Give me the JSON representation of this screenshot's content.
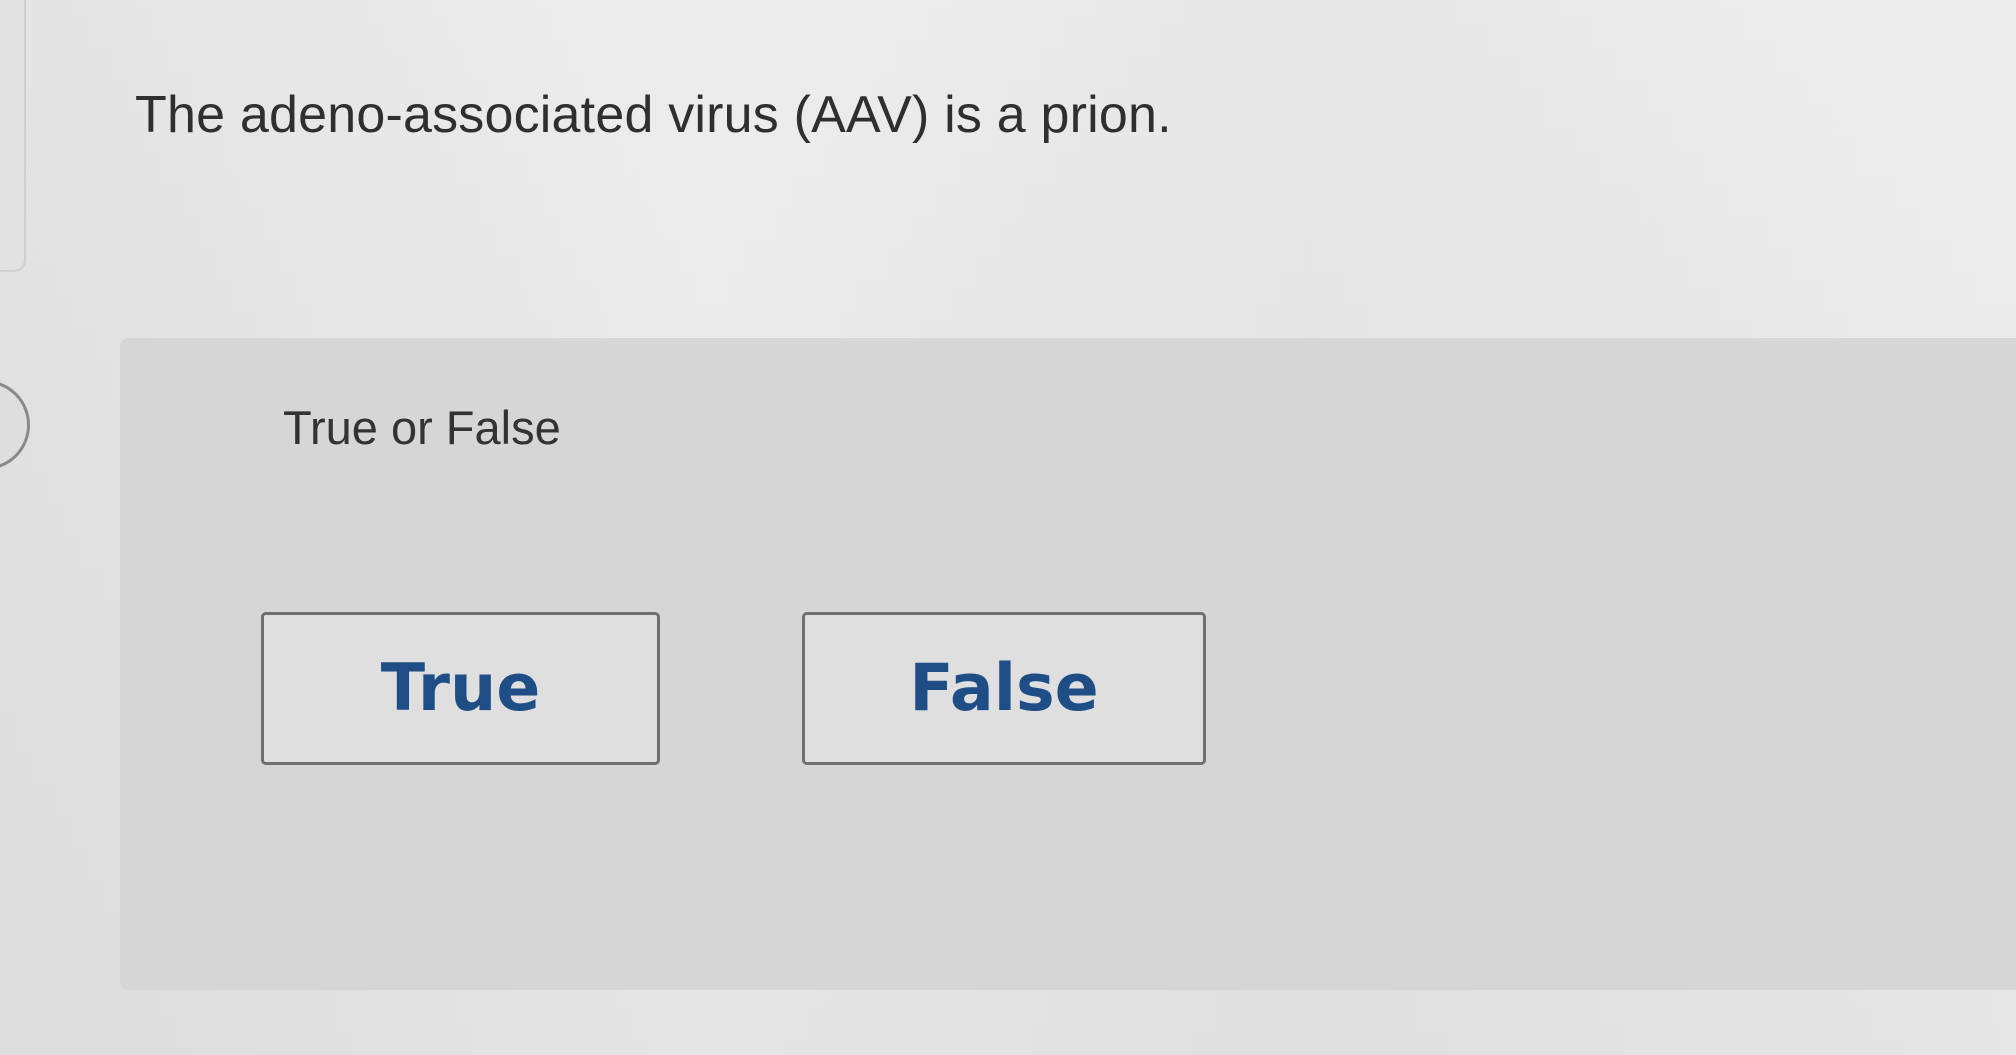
{
  "question": {
    "text": "The adeno-associated virus (AAV) is a prion."
  },
  "answer_section": {
    "prompt": "True or False",
    "options": [
      {
        "label": "True"
      },
      {
        "label": "False"
      }
    ]
  },
  "colors": {
    "background": "#e6e6e6",
    "panel": "#d6d6d6",
    "text": "#2f2f2f",
    "button_text": "#1f4e86",
    "button_border": "#6f6f6f"
  }
}
